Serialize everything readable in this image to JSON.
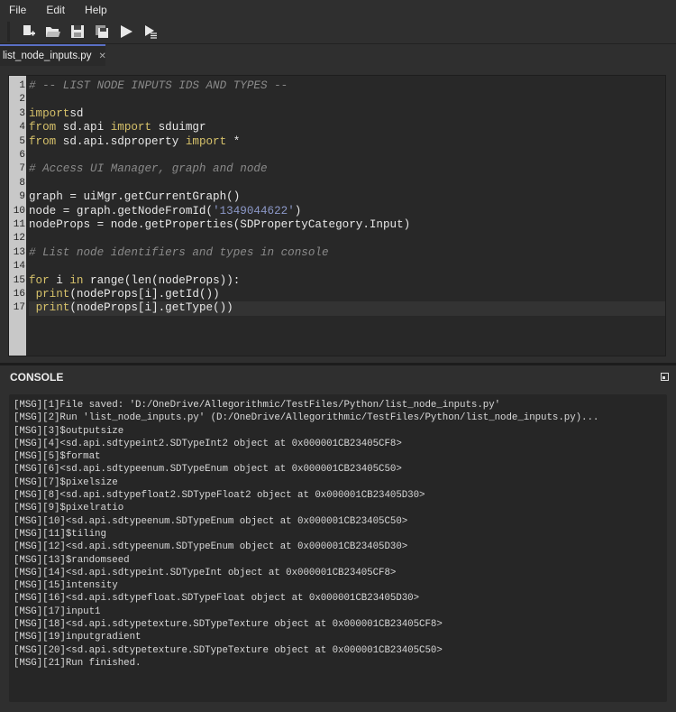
{
  "menu": [
    "File",
    "Edit",
    "Help"
  ],
  "toolbar": [
    "new-file-icon",
    "open-folder-icon",
    "save-icon",
    "save-all-icon",
    "run-icon",
    "run-selection-icon"
  ],
  "tab": {
    "label": "list_node_inputs.py",
    "close": "✕"
  },
  "code": [
    [
      [
        "cm",
        "# -- LIST NODE INPUTS IDS AND TYPES --"
      ]
    ],
    [],
    [
      [
        "kw",
        "import"
      ],
      [
        "",
        "sd"
      ]
    ],
    [
      [
        "kw",
        "from"
      ],
      [
        "",
        " sd.api "
      ],
      [
        "kw",
        "import"
      ],
      [
        "",
        " sduimgr"
      ]
    ],
    [
      [
        "kw",
        "from"
      ],
      [
        "",
        " sd.api.sdproperty "
      ],
      [
        "kw",
        "import"
      ],
      [
        "",
        " *"
      ]
    ],
    [],
    [
      [
        "cm",
        "# Access UI Manager, graph and node"
      ]
    ],
    [],
    [
      [
        "",
        "graph = uiMgr.getCurrentGraph()"
      ]
    ],
    [
      [
        "",
        "node = graph.getNodeFromId("
      ],
      [
        "st",
        "'1349044622'"
      ],
      [
        "",
        ")"
      ]
    ],
    [
      [
        "",
        "nodeProps = node.getProperties(SDPropertyCategory.Input)"
      ]
    ],
    [],
    [
      [
        "cm",
        "# List node identifiers and types in console"
      ]
    ],
    [],
    [
      [
        "kw",
        "for"
      ],
      [
        "",
        " i "
      ],
      [
        "kw",
        "in"
      ],
      [
        "",
        " range(len(nodeProps)):"
      ]
    ],
    [
      [
        "",
        " "
      ],
      [
        "kw",
        "print"
      ],
      [
        "",
        "(nodeProps[i].getId())"
      ]
    ],
    [
      [
        "",
        " "
      ],
      [
        "kw",
        "print"
      ],
      [
        "",
        "(nodeProps[i].getType())"
      ]
    ]
  ],
  "console": {
    "title": "CONSOLE",
    "lines": [
      "[MSG][1]File saved: 'D:/OneDrive/Allegorithmic/TestFiles/Python/list_node_inputs.py'",
      "[MSG][2]Run 'list_node_inputs.py' (D:/OneDrive/Allegorithmic/TestFiles/Python/list_node_inputs.py)...",
      "[MSG][3]$outputsize",
      "[MSG][4]<sd.api.sdtypeint2.SDTypeInt2 object at 0x000001CB23405CF8>",
      "[MSG][5]$format",
      "[MSG][6]<sd.api.sdtypeenum.SDTypeEnum object at 0x000001CB23405C50>",
      "[MSG][7]$pixelsize",
      "[MSG][8]<sd.api.sdtypefloat2.SDTypeFloat2 object at 0x000001CB23405D30>",
      "[MSG][9]$pixelratio",
      "[MSG][10]<sd.api.sdtypeenum.SDTypeEnum object at 0x000001CB23405C50>",
      "[MSG][11]$tiling",
      "[MSG][12]<sd.api.sdtypeenum.SDTypeEnum object at 0x000001CB23405D30>",
      "[MSG][13]$randomseed",
      "[MSG][14]<sd.api.sdtypeint.SDTypeInt object at 0x000001CB23405CF8>",
      "[MSG][15]intensity",
      "[MSG][16]<sd.api.sdtypefloat.SDTypeFloat object at 0x000001CB23405D30>",
      "[MSG][17]input1",
      "[MSG][18]<sd.api.sdtypetexture.SDTypeTexture object at 0x000001CB23405CF8>",
      "[MSG][19]inputgradient",
      "[MSG][20]<sd.api.sdtypetexture.SDTypeTexture object at 0x000001CB23405C50>",
      "[MSG][21]Run finished."
    ]
  }
}
